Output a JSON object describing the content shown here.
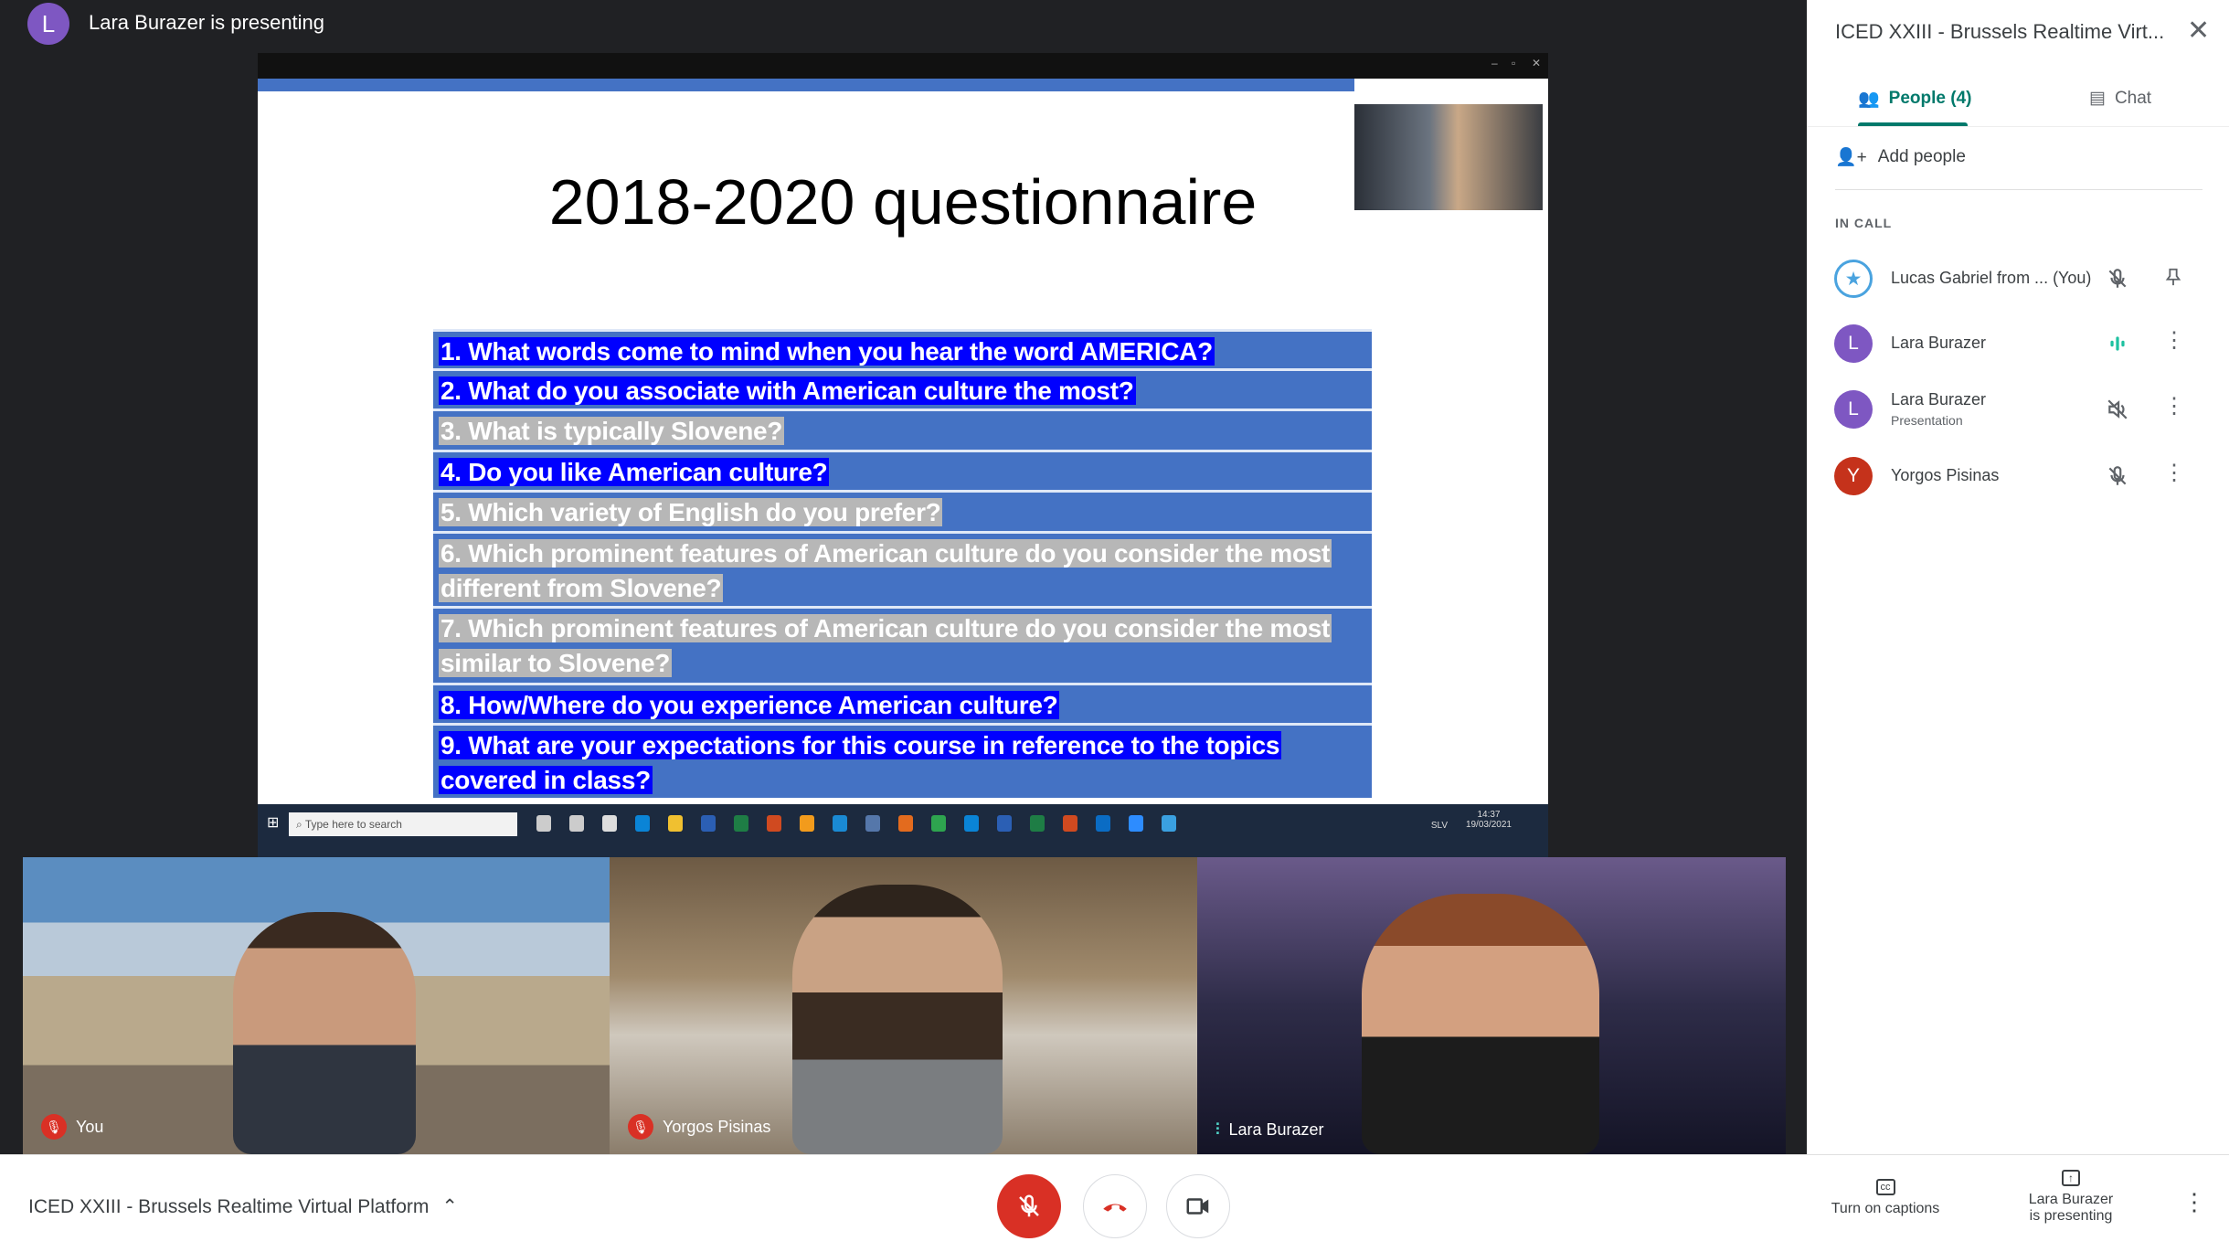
{
  "header": {
    "presenter_initial": "L",
    "presenting_text": "Lara Burazer is presenting"
  },
  "slide": {
    "title": "2018-2020 questionnaire",
    "questions": [
      {
        "text": "1. What words come to mind when you hear the word AMERICA?",
        "highlight": "blue"
      },
      {
        "text": "2. What do you associate with American culture the most?",
        "highlight": "blue"
      },
      {
        "text": "3. What is typically Slovene?",
        "highlight": "gray"
      },
      {
        "text": "4. Do you like American culture?",
        "highlight": "blue"
      },
      {
        "text": "5. Which variety of English do you prefer?",
        "highlight": "gray"
      },
      {
        "text": "6. Which prominent features of American culture do you consider the most different from Slovene?",
        "highlight": "gray"
      },
      {
        "text": "7. Which prominent features of American culture do you consider the most similar to Slovene?",
        "highlight": "gray"
      },
      {
        "text": "8. How/Where do you experience American culture?",
        "highlight": "blue"
      },
      {
        "text": "9. What are your expectations for this course in reference to the topics covered in class?",
        "highlight": "blue"
      }
    ],
    "colors": {
      "box": "#4472c4",
      "highlight_blue": "#0000ff",
      "highlight_gray": "#b7b7b7"
    }
  },
  "taskbar": {
    "search_placeholder": "Type here to search",
    "time": "14:37",
    "date": "19/03/2021",
    "lang": "SLV"
  },
  "tiles": [
    {
      "label": "You",
      "status": "muted"
    },
    {
      "label": "Yorgos Pisinas",
      "status": "muted"
    },
    {
      "label": "Lara Burazer",
      "status": "speaking"
    }
  ],
  "panel": {
    "title": "ICED XXIII - Brussels Realtime Virt...",
    "tabs": [
      {
        "label": "People (4)",
        "active": true
      },
      {
        "label": "Chat",
        "active": false
      }
    ],
    "add_people": "Add people",
    "section": "IN CALL",
    "participants": [
      {
        "initial": "",
        "name": "Lucas Gabriel from ... (You)",
        "sub": "",
        "status": "muted",
        "action": "pin-icon"
      },
      {
        "initial": "L",
        "name": "Lara Burazer",
        "sub": "",
        "status": "speaking",
        "color": "#7e57c2",
        "action": "more-icon"
      },
      {
        "initial": "L",
        "name": "Lara Burazer",
        "sub": "Presentation",
        "status": "audio-off",
        "color": "#7e57c2",
        "action": "more-icon"
      },
      {
        "initial": "Y",
        "name": "Yorgos Pisinas",
        "sub": "",
        "status": "muted",
        "color": "#c5321b",
        "action": "more-icon"
      }
    ]
  },
  "bottom": {
    "meeting_title": "ICED XXIII - Brussels Realtime Virtual Platform",
    "captions": "Turn on captions",
    "presenting_line1": "Lara Burazer",
    "presenting_line2": "is presenting"
  },
  "colors": {
    "accent": "#00796b",
    "danger": "#d93025"
  }
}
